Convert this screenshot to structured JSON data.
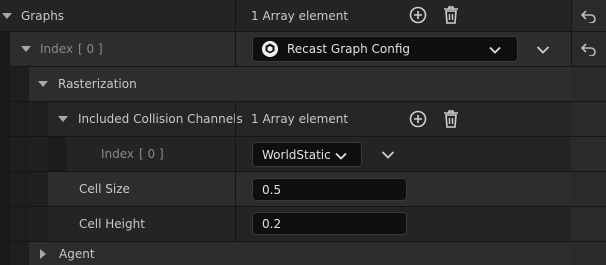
{
  "rows": {
    "graphs": {
      "label": "Graphs",
      "value": "1 Array element"
    },
    "index0": {
      "label": "Index",
      "index": "[ 0 ]",
      "value": "Recast Graph Config"
    },
    "rasterization": {
      "label": "Rasterization"
    },
    "included_collision": {
      "label": "Included Collision Channels",
      "value": "1 Array element"
    },
    "index_inner": {
      "label": "Index",
      "index": "[ 0 ]",
      "value": "WorldStatic"
    },
    "cell_size": {
      "label": "Cell Size",
      "value": "0.5"
    },
    "cell_height": {
      "label": "Cell Height",
      "value": "0.2"
    },
    "agent": {
      "label": "Agent"
    }
  },
  "icons": {
    "add": "add-element-icon",
    "delete": "delete-array-icon",
    "reset": "reset-to-default-icon",
    "expand": "expand-triangle-icon",
    "collapse": "collapse-triangle-icon",
    "asset": "asset-class-icon"
  },
  "colors": {
    "background": "#151515",
    "row_dark": "#242424",
    "row_light": "#2d2d2d",
    "input_bg": "#0f0f0f",
    "text": "#c8c8c8"
  }
}
